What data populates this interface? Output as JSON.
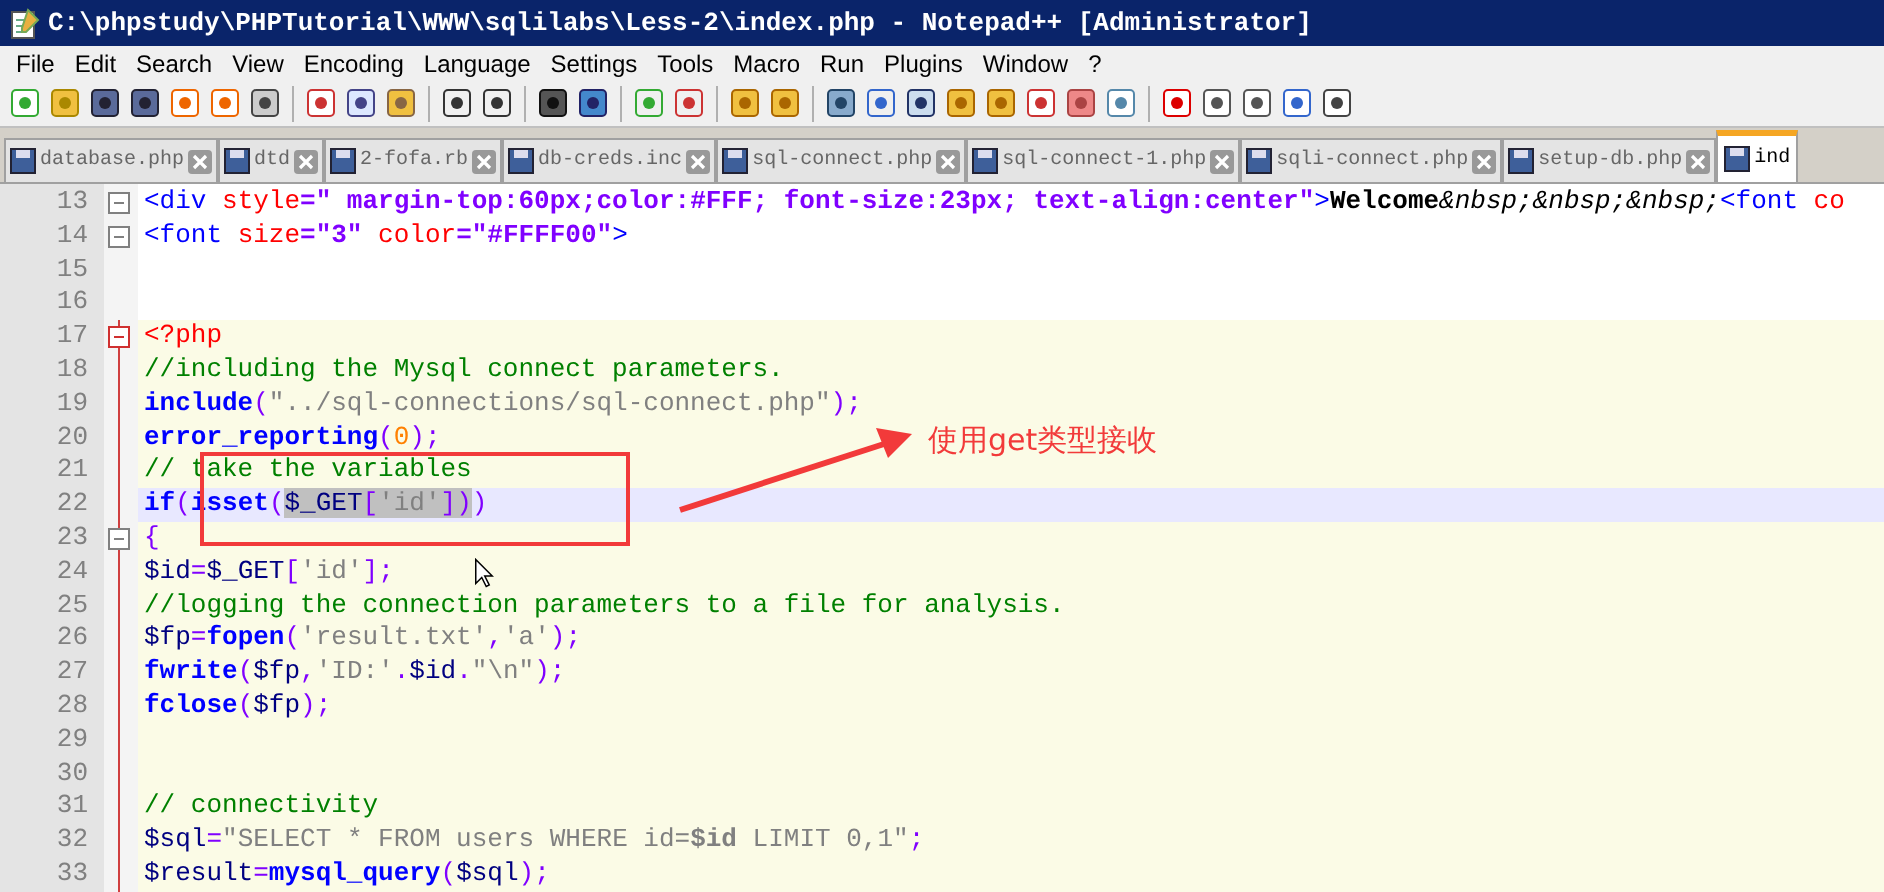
{
  "window": {
    "title": "C:\\phpstudy\\PHPTutorial\\WWW\\sqlilabs\\Less-2\\index.php - Notepad++ [Administrator]"
  },
  "menu": [
    "File",
    "Edit",
    "Search",
    "View",
    "Encoding",
    "Language",
    "Settings",
    "Tools",
    "Macro",
    "Run",
    "Plugins",
    "Window",
    "?"
  ],
  "tabs": [
    {
      "label": "database.php",
      "selected": false
    },
    {
      "label": "dtd",
      "selected": false
    },
    {
      "label": "2-fofa.rb",
      "selected": false
    },
    {
      "label": "db-creds.inc",
      "selected": false
    },
    {
      "label": "sql-connect.php",
      "selected": false
    },
    {
      "label": "sql-connect-1.php",
      "selected": false
    },
    {
      "label": "sqli-connect.php",
      "selected": false
    },
    {
      "label": "setup-db.php",
      "selected": false
    },
    {
      "label": "ind",
      "selected": true
    }
  ],
  "editor": {
    "lines": [
      {
        "number": "13",
        "fold": true,
        "php": false,
        "current": false,
        "tokens": [
          {
            "kind": "tag",
            "text": "<div"
          },
          {
            "kind": "attr",
            "text": " style"
          },
          {
            "kind": "value",
            "text": "=\" margin-top:60px;color:#FFF; font-size:23px; text-align:center\""
          },
          {
            "kind": "tag",
            "text": ">"
          },
          {
            "kind": "text",
            "text": "Welcome"
          },
          {
            "kind": "entity",
            "text": "&nbsp;&nbsp;&nbsp;"
          },
          {
            "kind": "tag",
            "text": "<font"
          },
          {
            "kind": "attr",
            "text": " co"
          }
        ]
      },
      {
        "number": "14",
        "fold": true,
        "php": false,
        "current": false,
        "tokens": [
          {
            "kind": "tag",
            "text": "<font"
          },
          {
            "kind": "attr",
            "text": " size"
          },
          {
            "kind": "value",
            "text": "=\"3\""
          },
          {
            "kind": "attr",
            "text": " color"
          },
          {
            "kind": "value",
            "text": "=\"#FFFF00\""
          },
          {
            "kind": "tag",
            "text": ">"
          }
        ]
      },
      {
        "number": "15",
        "php": false,
        "current": false
      },
      {
        "number": "16",
        "php": false,
        "current": false
      },
      {
        "number": "17",
        "fold": true,
        "php": true,
        "current": false,
        "tokens": [
          {
            "kind": "phptag",
            "text": "<?php"
          }
        ]
      },
      {
        "number": "18",
        "php": true,
        "current": false,
        "tokens": [
          {
            "kind": "comment",
            "text": "//including the Mysql connect parameters."
          }
        ]
      },
      {
        "number": "19",
        "php": true,
        "current": false,
        "tokens": [
          {
            "kind": "keyword",
            "text": "include"
          },
          {
            "kind": "op",
            "text": "("
          },
          {
            "kind": "string",
            "text": "\"../sql-connections/sql-connect.php\""
          },
          {
            "kind": "op",
            "text": ");"
          }
        ]
      },
      {
        "number": "20",
        "php": true,
        "current": false,
        "tokens": [
          {
            "kind": "keyword",
            "text": "error_reporting"
          },
          {
            "kind": "op",
            "text": "("
          },
          {
            "kind": "number",
            "text": "0"
          },
          {
            "kind": "op",
            "text": ");"
          }
        ]
      },
      {
        "number": "21",
        "php": true,
        "current": false,
        "tokens": [
          {
            "kind": "comment",
            "text": "// take the variables"
          }
        ]
      },
      {
        "number": "22",
        "php": true,
        "current": true,
        "tokens": [
          {
            "kind": "keyword",
            "text": "if",
            "selected": false
          },
          {
            "kind": "op",
            "text": "(",
            "selected": false
          },
          {
            "kind": "keyword",
            "text": "isset",
            "selected": false
          },
          {
            "kind": "op",
            "text": "(",
            "selected": false
          },
          {
            "kind": "var",
            "text": "$_GET",
            "selected": true
          },
          {
            "kind": "op",
            "text": "[",
            "selected": true
          },
          {
            "kind": "string",
            "text": "'id'",
            "selected": true
          },
          {
            "kind": "op",
            "text": "])",
            "selected": true
          },
          {
            "kind": "op",
            "text": ")",
            "selected": false
          }
        ]
      },
      {
        "number": "23",
        "fold": true,
        "php": true,
        "current": false,
        "tokens": [
          {
            "kind": "op",
            "text": "{"
          }
        ]
      },
      {
        "number": "24",
        "php": true,
        "current": false,
        "tokens": [
          {
            "kind": "var",
            "text": "$id"
          },
          {
            "kind": "op",
            "text": "="
          },
          {
            "kind": "var",
            "text": "$_GET"
          },
          {
            "kind": "op",
            "text": "["
          },
          {
            "kind": "string",
            "text": "'id'"
          },
          {
            "kind": "op",
            "text": "];"
          }
        ]
      },
      {
        "number": "25",
        "php": true,
        "current": false,
        "tokens": [
          {
            "kind": "comment",
            "text": "//logging the connection parameters to a file for analysis."
          }
        ]
      },
      {
        "number": "26",
        "php": true,
        "current": false,
        "tokens": [
          {
            "kind": "var",
            "text": "$fp"
          },
          {
            "kind": "op",
            "text": "="
          },
          {
            "kind": "keyword",
            "text": "fopen"
          },
          {
            "kind": "op",
            "text": "("
          },
          {
            "kind": "string",
            "text": "'result.txt'"
          },
          {
            "kind": "op",
            "text": ","
          },
          {
            "kind": "string",
            "text": "'a'"
          },
          {
            "kind": "op",
            "text": ");"
          }
        ]
      },
      {
        "number": "27",
        "php": true,
        "current": false,
        "tokens": [
          {
            "kind": "keyword",
            "text": "fwrite"
          },
          {
            "kind": "op",
            "text": "("
          },
          {
            "kind": "var",
            "text": "$fp"
          },
          {
            "kind": "op",
            "text": ","
          },
          {
            "kind": "string",
            "text": "'ID:'"
          },
          {
            "kind": "op",
            "text": "."
          },
          {
            "kind": "var",
            "text": "$id"
          },
          {
            "kind": "op",
            "text": "."
          },
          {
            "kind": "string",
            "text": "\"\\n\""
          },
          {
            "kind": "op",
            "text": ");"
          }
        ]
      },
      {
        "number": "28",
        "php": true,
        "current": false,
        "tokens": [
          {
            "kind": "keyword",
            "text": "fclose"
          },
          {
            "kind": "op",
            "text": "("
          },
          {
            "kind": "var",
            "text": "$fp"
          },
          {
            "kind": "op",
            "text": ");"
          }
        ]
      },
      {
        "number": "29",
        "php": true,
        "current": false
      },
      {
        "number": "30",
        "php": true,
        "current": false
      },
      {
        "number": "31",
        "php": true,
        "current": false,
        "tokens": [
          {
            "kind": "comment",
            "text": "// connectivity"
          }
        ]
      },
      {
        "number": "32",
        "php": true,
        "current": false,
        "tokens": [
          {
            "kind": "var",
            "text": "$sql"
          },
          {
            "kind": "op",
            "text": "="
          },
          {
            "kind": "string",
            "text": "\"SELECT * FROM users WHERE id="
          },
          {
            "kind": "strvar",
            "text": "$id"
          },
          {
            "kind": "string",
            "text": " LIMIT 0,1\""
          },
          {
            "kind": "op",
            "text": ";"
          }
        ]
      },
      {
        "number": "33",
        "php": true,
        "current": false,
        "tokens": [
          {
            "kind": "var",
            "text": "$result"
          },
          {
            "kind": "op",
            "text": "="
          },
          {
            "kind": "keyword",
            "text": "mysql_query"
          },
          {
            "kind": "op",
            "text": "("
          },
          {
            "kind": "var",
            "text": "$sql"
          },
          {
            "kind": "op",
            "text": ");"
          }
        ]
      }
    ]
  },
  "annotation": {
    "text": "使用get类型接收"
  }
}
